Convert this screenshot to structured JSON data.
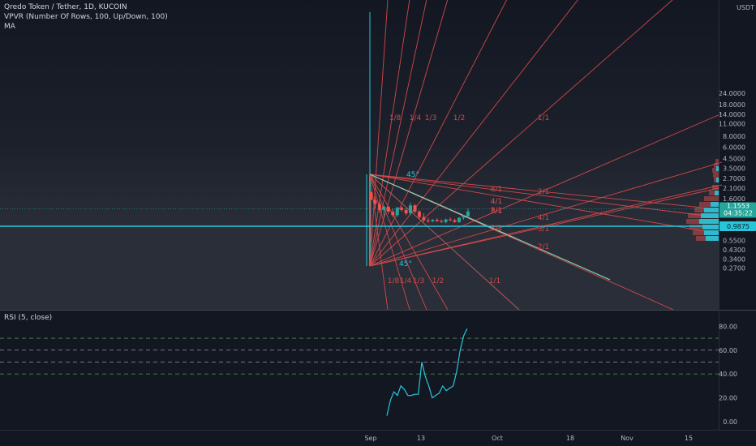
{
  "header": {
    "title": "Qredo Token / Tether, 1D, KUCOIN",
    "indicator_vpvr": "VPVR (Number Of Rows, 100, Up/Down, 100)",
    "indicator_ma": "MA",
    "rsi_title": "RSI (5, close)"
  },
  "colors": {
    "background": "#131722",
    "fan": "#d04848",
    "teal": "#26c6da",
    "up": "#26a69a",
    "down": "#ef5350",
    "trend": "#c5e1a5"
  },
  "price_axis": {
    "unit": "USDT",
    "labels": [
      "24.0000",
      "18.0000",
      "14.0000",
      "11.0000",
      "8.0000",
      "6.0000",
      "4.5000",
      "3.5000",
      "2.7000",
      "2.1000",
      "1.6000",
      "0.7500",
      "0.5500",
      "0.4300",
      "0.3400",
      "0.2700"
    ],
    "values": [
      24,
      18,
      14,
      11,
      8,
      6,
      4.5,
      3.5,
      2.7,
      2.1,
      1.6,
      0.75,
      0.55,
      0.43,
      0.34,
      0.27
    ],
    "last_price": "1.1553",
    "countdown": "04:35:22",
    "ref_price": "0.9875"
  },
  "time_axis": {
    "labels": [
      "Sep",
      "13",
      "Oct",
      "18",
      "Nov",
      "15"
    ]
  },
  "fan_labels_top": [
    "1/8",
    "1/4",
    "1/3",
    "1/2",
    "1/1"
  ],
  "fan_labels_bottom": [
    "1/8",
    "1/4",
    "1/3",
    "1/2",
    "1/1"
  ],
  "fan_labels_right": [
    "8/1",
    "4/1",
    "3/1",
    "2/1",
    "8/1",
    "4/1",
    "3/1",
    "2/1",
    "4/1",
    "8/1"
  ],
  "angle_labels": [
    "45°",
    "45°"
  ],
  "rsi_axis": {
    "labels": [
      "80.00",
      "60.00",
      "40.00",
      "20.00",
      "0.00"
    ],
    "values": [
      80,
      60,
      40,
      20,
      0
    ]
  },
  "chart_data": [
    {
      "type": "candlestick",
      "title": "Qredo Token / Tether, 1D, KUCOIN",
      "xlabel": "",
      "ylabel": "USDT",
      "y_scale": "log",
      "ylim": [
        0.27,
        24
      ],
      "x_ticks": [
        "Sep",
        "13",
        "Oct",
        "18",
        "Nov",
        "15"
      ],
      "candles": [
        {
          "o": 1.9,
          "h": 1.95,
          "l": 0.52,
          "c": 1.55
        },
        {
          "o": 1.55,
          "h": 1.7,
          "l": 1.25,
          "c": 1.4
        },
        {
          "o": 1.4,
          "h": 1.5,
          "l": 1.1,
          "c": 1.2
        },
        {
          "o": 1.2,
          "h": 1.35,
          "l": 1.0,
          "c": 1.3
        },
        {
          "o": 1.3,
          "h": 1.33,
          "l": 1.08,
          "c": 1.15
        },
        {
          "o": 1.15,
          "h": 1.24,
          "l": 1.0,
          "c": 1.05
        },
        {
          "o": 1.05,
          "h": 1.3,
          "l": 1.0,
          "c": 1.27
        },
        {
          "o": 1.27,
          "h": 1.32,
          "l": 1.15,
          "c": 1.2
        },
        {
          "o": 1.2,
          "h": 1.25,
          "l": 1.05,
          "c": 1.1
        },
        {
          "o": 1.1,
          "h": 1.45,
          "l": 1.05,
          "c": 1.35
        },
        {
          "o": 1.35,
          "h": 1.4,
          "l": 1.1,
          "c": 1.15
        },
        {
          "o": 1.15,
          "h": 1.2,
          "l": 0.95,
          "c": 1.0
        },
        {
          "o": 1.0,
          "h": 1.1,
          "l": 0.88,
          "c": 0.92
        },
        {
          "o": 0.92,
          "h": 0.98,
          "l": 0.86,
          "c": 0.9
        },
        {
          "o": 0.9,
          "h": 0.95,
          "l": 0.87,
          "c": 0.93
        },
        {
          "o": 0.93,
          "h": 0.97,
          "l": 0.88,
          "c": 0.9
        },
        {
          "o": 0.9,
          "h": 0.94,
          "l": 0.86,
          "c": 0.88
        },
        {
          "o": 0.88,
          "h": 0.96,
          "l": 0.85,
          "c": 0.94
        },
        {
          "o": 0.94,
          "h": 0.99,
          "l": 0.9,
          "c": 0.92
        },
        {
          "o": 0.92,
          "h": 0.96,
          "l": 0.86,
          "c": 0.88
        },
        {
          "o": 0.88,
          "h": 1.0,
          "l": 0.86,
          "c": 0.98
        },
        {
          "o": 0.98,
          "h": 1.05,
          "l": 0.93,
          "c": 1.02
        },
        {
          "o": 1.02,
          "h": 1.25,
          "l": 0.98,
          "c": 1.155
        }
      ]
    },
    {
      "type": "line",
      "title": "RSI (5, close)",
      "xlabel": "",
      "ylabel": "",
      "ylim": [
        0,
        85
      ],
      "grid": false,
      "levels": [
        70,
        60,
        50,
        40
      ],
      "values": [
        5,
        18,
        25,
        22,
        30,
        27,
        22,
        22,
        23,
        23,
        50,
        38,
        30,
        20,
        22,
        24,
        30,
        26,
        28,
        30,
        42,
        60,
        72,
        78
      ]
    }
  ]
}
